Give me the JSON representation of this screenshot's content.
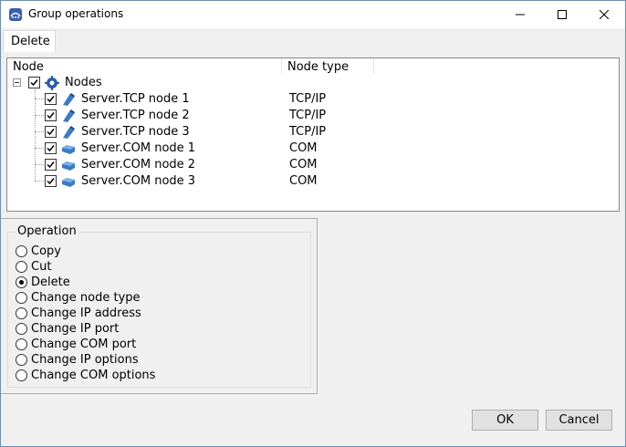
{
  "window": {
    "title": "Group operations"
  },
  "tabs": [
    {
      "label": "Delete"
    }
  ],
  "tree": {
    "columns": [
      "Node",
      "Node type"
    ],
    "root": {
      "label": "Nodes",
      "checked": true
    },
    "rows": [
      {
        "label": "Server.TCP node 1",
        "type": "TCP/IP",
        "icon": "tcp-node-icon",
        "checked": true
      },
      {
        "label": "Server.TCP node 2",
        "type": "TCP/IP",
        "icon": "tcp-node-icon",
        "checked": true
      },
      {
        "label": "Server.TCP node 3",
        "type": "TCP/IP",
        "icon": "tcp-node-icon",
        "checked": true
      },
      {
        "label": "Server.COM node 1",
        "type": "COM",
        "icon": "com-node-icon",
        "checked": true
      },
      {
        "label": "Server.COM node 2",
        "type": "COM",
        "icon": "com-node-icon",
        "checked": true
      },
      {
        "label": "Server.COM node 3",
        "type": "COM",
        "icon": "com-node-icon",
        "checked": true
      }
    ]
  },
  "operation": {
    "title": "Operation",
    "selected": "Delete",
    "options": [
      "Copy",
      "Cut",
      "Delete",
      "Change node type",
      "Change IP address",
      "Change IP port",
      "Change COM port",
      "Change IP options",
      "Change COM options"
    ]
  },
  "buttons": {
    "ok": "OK",
    "cancel": "Cancel"
  }
}
